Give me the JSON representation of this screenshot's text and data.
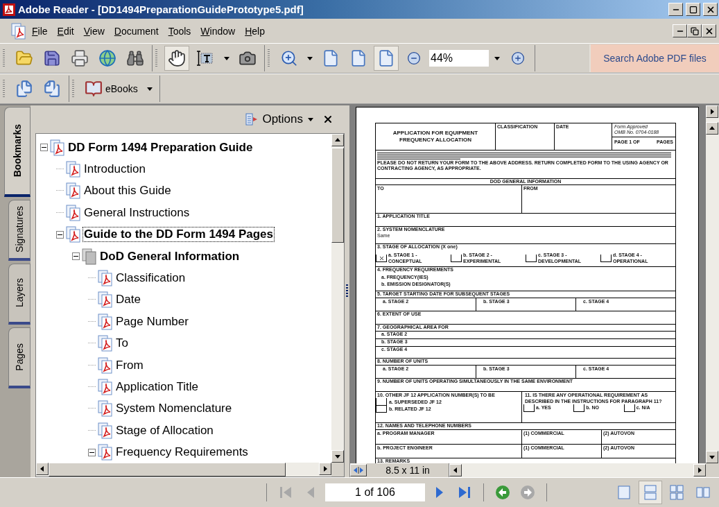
{
  "window": {
    "title": "Adobe Reader - [DD1494PreparationGuidePrototype5.pdf]"
  },
  "menu": [
    "File",
    "Edit",
    "View",
    "Document",
    "Tools",
    "Window",
    "Help"
  ],
  "toolbar_1": [
    [
      {
        "kind": "open",
        "selected": false
      },
      {
        "kind": "save",
        "selected": false
      },
      {
        "kind": "print",
        "selected": false
      },
      {
        "kind": "email",
        "selected": false
      },
      {
        "kind": "find",
        "selected": false
      }
    ],
    [
      {
        "kind": "hand",
        "selected": true
      },
      {
        "kind": "select",
        "selected": false
      },
      {
        "kind": "caret",
        "selected": false
      },
      {
        "kind": "snapshot",
        "selected": false
      }
    ],
    [
      {
        "kind": "zoom",
        "selected": false
      },
      {
        "kind": "caret",
        "selected": false
      },
      {
        "kind": "page",
        "selected": false
      },
      {
        "kind": "page",
        "selected": false
      },
      {
        "kind": "page",
        "selected": true
      },
      {
        "kind": "zoom-out",
        "selected": false
      },
      {
        "kind": "field",
        "value": "44%",
        "selected": false
      },
      {
        "kind": "caret",
        "selected": false
      },
      {
        "kind": "zoom-in",
        "selected": false
      }
    ]
  ],
  "search_button": "Search Adobe PDF files",
  "toolbar_2": {
    "ebooks": "eBooks"
  },
  "side_tabs": [
    {
      "label": "Bookmarks",
      "selected": true
    },
    {
      "label": "Signatures",
      "selected": false
    },
    {
      "label": "Layers",
      "selected": false
    },
    {
      "label": "Pages",
      "selected": false
    }
  ],
  "bookmarks": {
    "options": "Options",
    "tree": [
      {
        "label": "DD Form 1494 Preparation Guide",
        "kind": "page",
        "bold": true,
        "focused": false,
        "expanded": true,
        "children": [
          {
            "label": "Introduction",
            "kind": "page",
            "bold": false,
            "focused": false
          },
          {
            "label": "About this Guide",
            "kind": "page",
            "bold": false,
            "focused": false
          },
          {
            "label": "General Instructions",
            "kind": "page",
            "bold": false,
            "focused": false
          },
          {
            "label": "Guide to the DD Form 1494 Pages",
            "kind": "page",
            "bold": true,
            "focused": true,
            "expanded": true,
            "children": [
              {
                "label": "DoD General Information",
                "kind": "section",
                "bold": true,
                "focused": false,
                "expanded": true,
                "children": [
                  {
                    "label": "Classification",
                    "kind": "page",
                    "bold": false,
                    "focused": false
                  },
                  {
                    "label": "Date",
                    "kind": "page",
                    "bold": false,
                    "focused": false
                  },
                  {
                    "label": "Page Number",
                    "kind": "page",
                    "bold": false,
                    "focused": false
                  },
                  {
                    "label": "To",
                    "kind": "page",
                    "bold": false,
                    "focused": false
                  },
                  {
                    "label": "From",
                    "kind": "page",
                    "bold": false,
                    "focused": false
                  },
                  {
                    "label": "Application Title",
                    "kind": "page",
                    "bold": false,
                    "focused": false
                  },
                  {
                    "label": "System Nomenclature",
                    "kind": "page",
                    "bold": false,
                    "focused": false
                  },
                  {
                    "label": "Stage of Allocation",
                    "kind": "page",
                    "bold": false,
                    "focused": false
                  },
                  {
                    "label": "Frequency Requirements",
                    "kind": "page",
                    "bold": false,
                    "focused": false,
                    "expanded": true
                  }
                ]
              }
            ]
          }
        ]
      }
    ]
  },
  "form": {
    "title": "APPLICATION FOR EQUIPMENT FREQUENCY ALLOCATION",
    "classification": "CLASSIFICATION",
    "date": "DATE",
    "approval": [
      "Form Approved",
      "OMB No. 0704-0188"
    ],
    "page_of": "PAGE 1 OF",
    "pages": "PAGES",
    "notice": "PLEASE DO NOT RETURN YOUR FORM TO THE ABOVE ADDRESS. RETURN COMPLETED FORM TO THE USING AGENCY OR CONTRACTING AGENCY, AS APPROPRIATE.",
    "section": "DOD GENERAL INFORMATION",
    "to": "TO",
    "from": "FROM",
    "rows": [
      {
        "kind": "line",
        "label": "1. APPLICATION TITLE"
      },
      {
        "kind": "line",
        "label": "2. SYSTEM NOMENCLATURE",
        "value": "Same"
      },
      {
        "kind": "stages",
        "label": "3. STAGE OF ALLOCATION (X one)",
        "options": [
          {
            "label": "a. STAGE 1 - CONCEPTUAL",
            "checked": true
          },
          {
            "label": "b. STAGE 2 - EXPERIMENTAL",
            "checked": false
          },
          {
            "label": "c. STAGE 3 - DEVELOPMENTAL",
            "checked": false
          },
          {
            "label": "d. STAGE 4 - OPERATIONAL",
            "checked": false
          }
        ]
      },
      {
        "kind": "list",
        "label": "4. FREQUENCY REQUIREMENTS",
        "items": [
          "a. FREQUENCY(IES)",
          "b. EMISSION DESIGNATOR(S)"
        ]
      },
      {
        "kind": "columns",
        "label": "5. TARGET STARTING DATE FOR SUBSEQUENT STAGES",
        "items": [
          "a. STAGE 2",
          "b. STAGE 3",
          "c. STAGE 4"
        ]
      },
      {
        "kind": "line",
        "label": "6. EXTENT OF USE"
      },
      {
        "kind": "rows",
        "label": "7. GEOGRAPHICAL AREA FOR",
        "items": [
          "a. STAGE 2",
          "b. STAGE 3",
          "c. STAGE 4"
        ]
      },
      {
        "kind": "columns",
        "label": "8. NUMBER OF UNITS",
        "items": [
          "a. STAGE 2",
          "b. STAGE 3",
          "c. STAGE 4"
        ]
      },
      {
        "kind": "line",
        "label": "9. NUMBER OF UNITS OPERATING SIMULTANEOUSLY IN THE SAME ENVIRONMENT"
      },
      {
        "kind": "split",
        "label": "10. OTHER JF 12 APPLICATION NUMBER(S) TO BE",
        "items": [
          {
            "label": "a. SUPERSEDED JF 12",
            "checked": false
          },
          {
            "label": "b. RELATED JF 12",
            "checked": false
          }
        ],
        "label_2": "11. IS THERE ANY OPERATIONAL REQUIREMENT AS DESCRIBED IN THE INSTRUCTIONS FOR PARAGRAPH 11?",
        "options": [
          {
            "label": "a. YES",
            "checked": false
          },
          {
            "label": "b. NO",
            "checked": false
          },
          {
            "label": "c. N/A",
            "checked": false
          }
        ]
      },
      {
        "kind": "contacts",
        "label": "12. NAMES AND TELEPHONE NUMBERS",
        "grid": [
          [
            "a. PROGRAM MANAGER",
            "(1) COMMERCIAL",
            "(2) AUTOVON"
          ],
          [
            "b. PROJECT ENGINEER",
            "(1) COMMERCIAL",
            "(2) AUTOVON"
          ]
        ]
      },
      {
        "kind": "remarks",
        "label": "13. REMARKS"
      }
    ]
  },
  "page_size": "8.5 x 11 in",
  "status": {
    "page": "1 of 106",
    "nav": [
      {
        "kind": "first",
        "disabled": true
      },
      {
        "kind": "prev",
        "disabled": true
      },
      {
        "kind": "field"
      },
      {
        "kind": "next",
        "disabled": false
      },
      {
        "kind": "last",
        "disabled": false
      },
      {
        "kind": "back",
        "disabled": false
      },
      {
        "kind": "forward",
        "disabled": true
      }
    ],
    "views": [
      {
        "kind": "single",
        "selected": false
      },
      {
        "kind": "continuous",
        "selected": true
      },
      {
        "kind": "continuous-facing",
        "selected": false
      },
      {
        "kind": "facing",
        "selected": false
      }
    ]
  }
}
